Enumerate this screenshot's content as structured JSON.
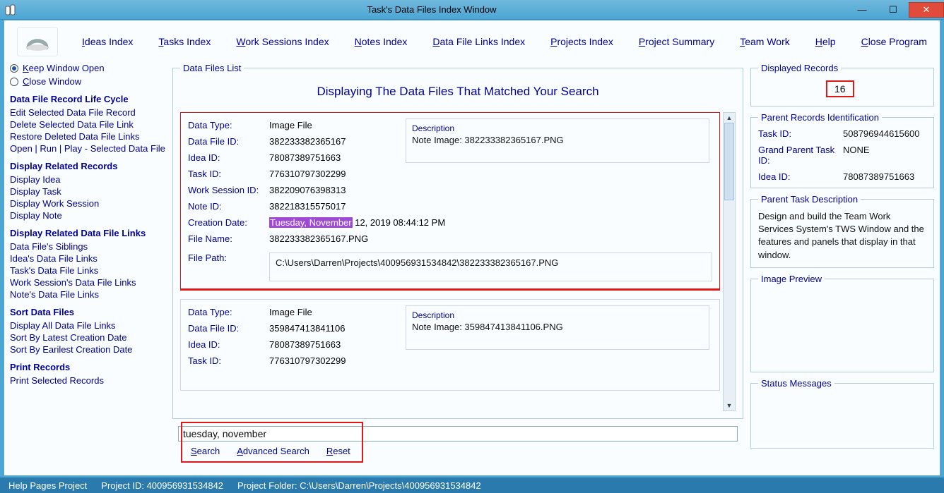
{
  "window": {
    "title": "Task's Data Files Index Window"
  },
  "menu": {
    "items": [
      {
        "pre": "I",
        "rest": "deas Index"
      },
      {
        "pre": "T",
        "rest": "asks Index"
      },
      {
        "pre": "W",
        "rest": "ork Sessions Index"
      },
      {
        "pre": "N",
        "rest": "otes Index"
      },
      {
        "pre": "D",
        "rest": "ata File Links Index"
      },
      {
        "pre": "P",
        "rest": "rojects Index"
      },
      {
        "pre": "P",
        "rest": "roject Summary"
      },
      {
        "pre": "T",
        "rest": "eam Work"
      },
      {
        "pre": "H",
        "rest": "elp"
      },
      {
        "pre": "C",
        "rest": "lose Program"
      }
    ]
  },
  "sidebar": {
    "radio_keep": "eep Window Open",
    "radio_keep_u": "K",
    "radio_close_u": "C",
    "radio_close": "lose Window",
    "groups": [
      {
        "h": "Data File Record Life Cycle",
        "items": [
          "Edit Selected Data File Record",
          "Delete Selected Data File Link",
          "Restore Deleted Data File Links",
          "Open | Run | Play - Selected Data File"
        ]
      },
      {
        "h": "Display Related Records",
        "items": [
          "Display Idea",
          "Display Task",
          "Display Work Session",
          "Display Note"
        ]
      },
      {
        "h": "Display Related Data File Links",
        "items": [
          "Data File's Siblings",
          "Idea's Data File Links",
          "Task's Data File Links",
          "Work Session's Data File Links",
          "Note's Data File Links"
        ]
      },
      {
        "h": "Sort Data Files",
        "items": [
          "Display All Data File Links",
          "Sort By Latest Creation Date",
          "Sort By Earilest Creation Date"
        ]
      },
      {
        "h": "Print Records",
        "items": [
          "Print Selected Records"
        ]
      }
    ]
  },
  "list": {
    "legend": "Data Files List",
    "heading": "Displaying The Data Files That Matched Your Search",
    "records": [
      {
        "data_type": "Image File",
        "data_file_id": "382233382365167",
        "idea_id": "78087389751663",
        "task_id": "776310797302299",
        "ws_id": "382209076398313",
        "note_id": "382218315575017",
        "date_hl": "Tuesday, November",
        "date_rest": " 12, 2019   08:44:12 PM",
        "file_name": "382233382365167.PNG",
        "file_path": "C:\\Users\\Darren\\Projects\\400956931534842\\382233382365167.PNG",
        "desc": "Note Image: 382233382365167.PNG"
      },
      {
        "data_type": "Image File",
        "data_file_id": "359847413841106",
        "idea_id": "78087389751663",
        "task_id": "776310797302299",
        "desc": "Note Image: 359847413841106.PNG"
      }
    ],
    "labels": {
      "data_type": "Data Type:",
      "data_file_id": "Data File ID:",
      "idea_id": "Idea ID:",
      "task_id": "Task ID:",
      "ws_id": "Work Session ID:",
      "note_id": "Note ID:",
      "date": "Creation Date:",
      "file_name": "File Name:",
      "file_path": "File Path:",
      "desc": "Description"
    }
  },
  "search": {
    "value": "tuesday, november",
    "btn_search_u": "S",
    "btn_search_r": "earch",
    "btn_adv_u": "A",
    "btn_adv_r": "dvanced Search",
    "btn_reset_u": "R",
    "btn_reset_r": "eset"
  },
  "right": {
    "disp_legend": "Displayed Records",
    "disp_val": "16",
    "parent_legend": "Parent Records Identification",
    "parent": {
      "task_l": "Task ID:",
      "task_v": "508796944615600",
      "gp_l": "Grand Parent Task ID:",
      "gp_v": "NONE",
      "idea_l": "Idea ID:",
      "idea_v": "78087389751663"
    },
    "ptd_legend": "Parent Task Description",
    "ptd_text": "Design and build the Team Work Services System's TWS Window and the features and panels that display in that window.",
    "img_legend": "Image Preview",
    "stat_legend": "Status Messages"
  },
  "status": {
    "help": "Help Pages Project",
    "pid": "Project ID: 400956931534842",
    "pfolder": "Project Folder: C:\\Users\\Darren\\Projects\\400956931534842"
  }
}
